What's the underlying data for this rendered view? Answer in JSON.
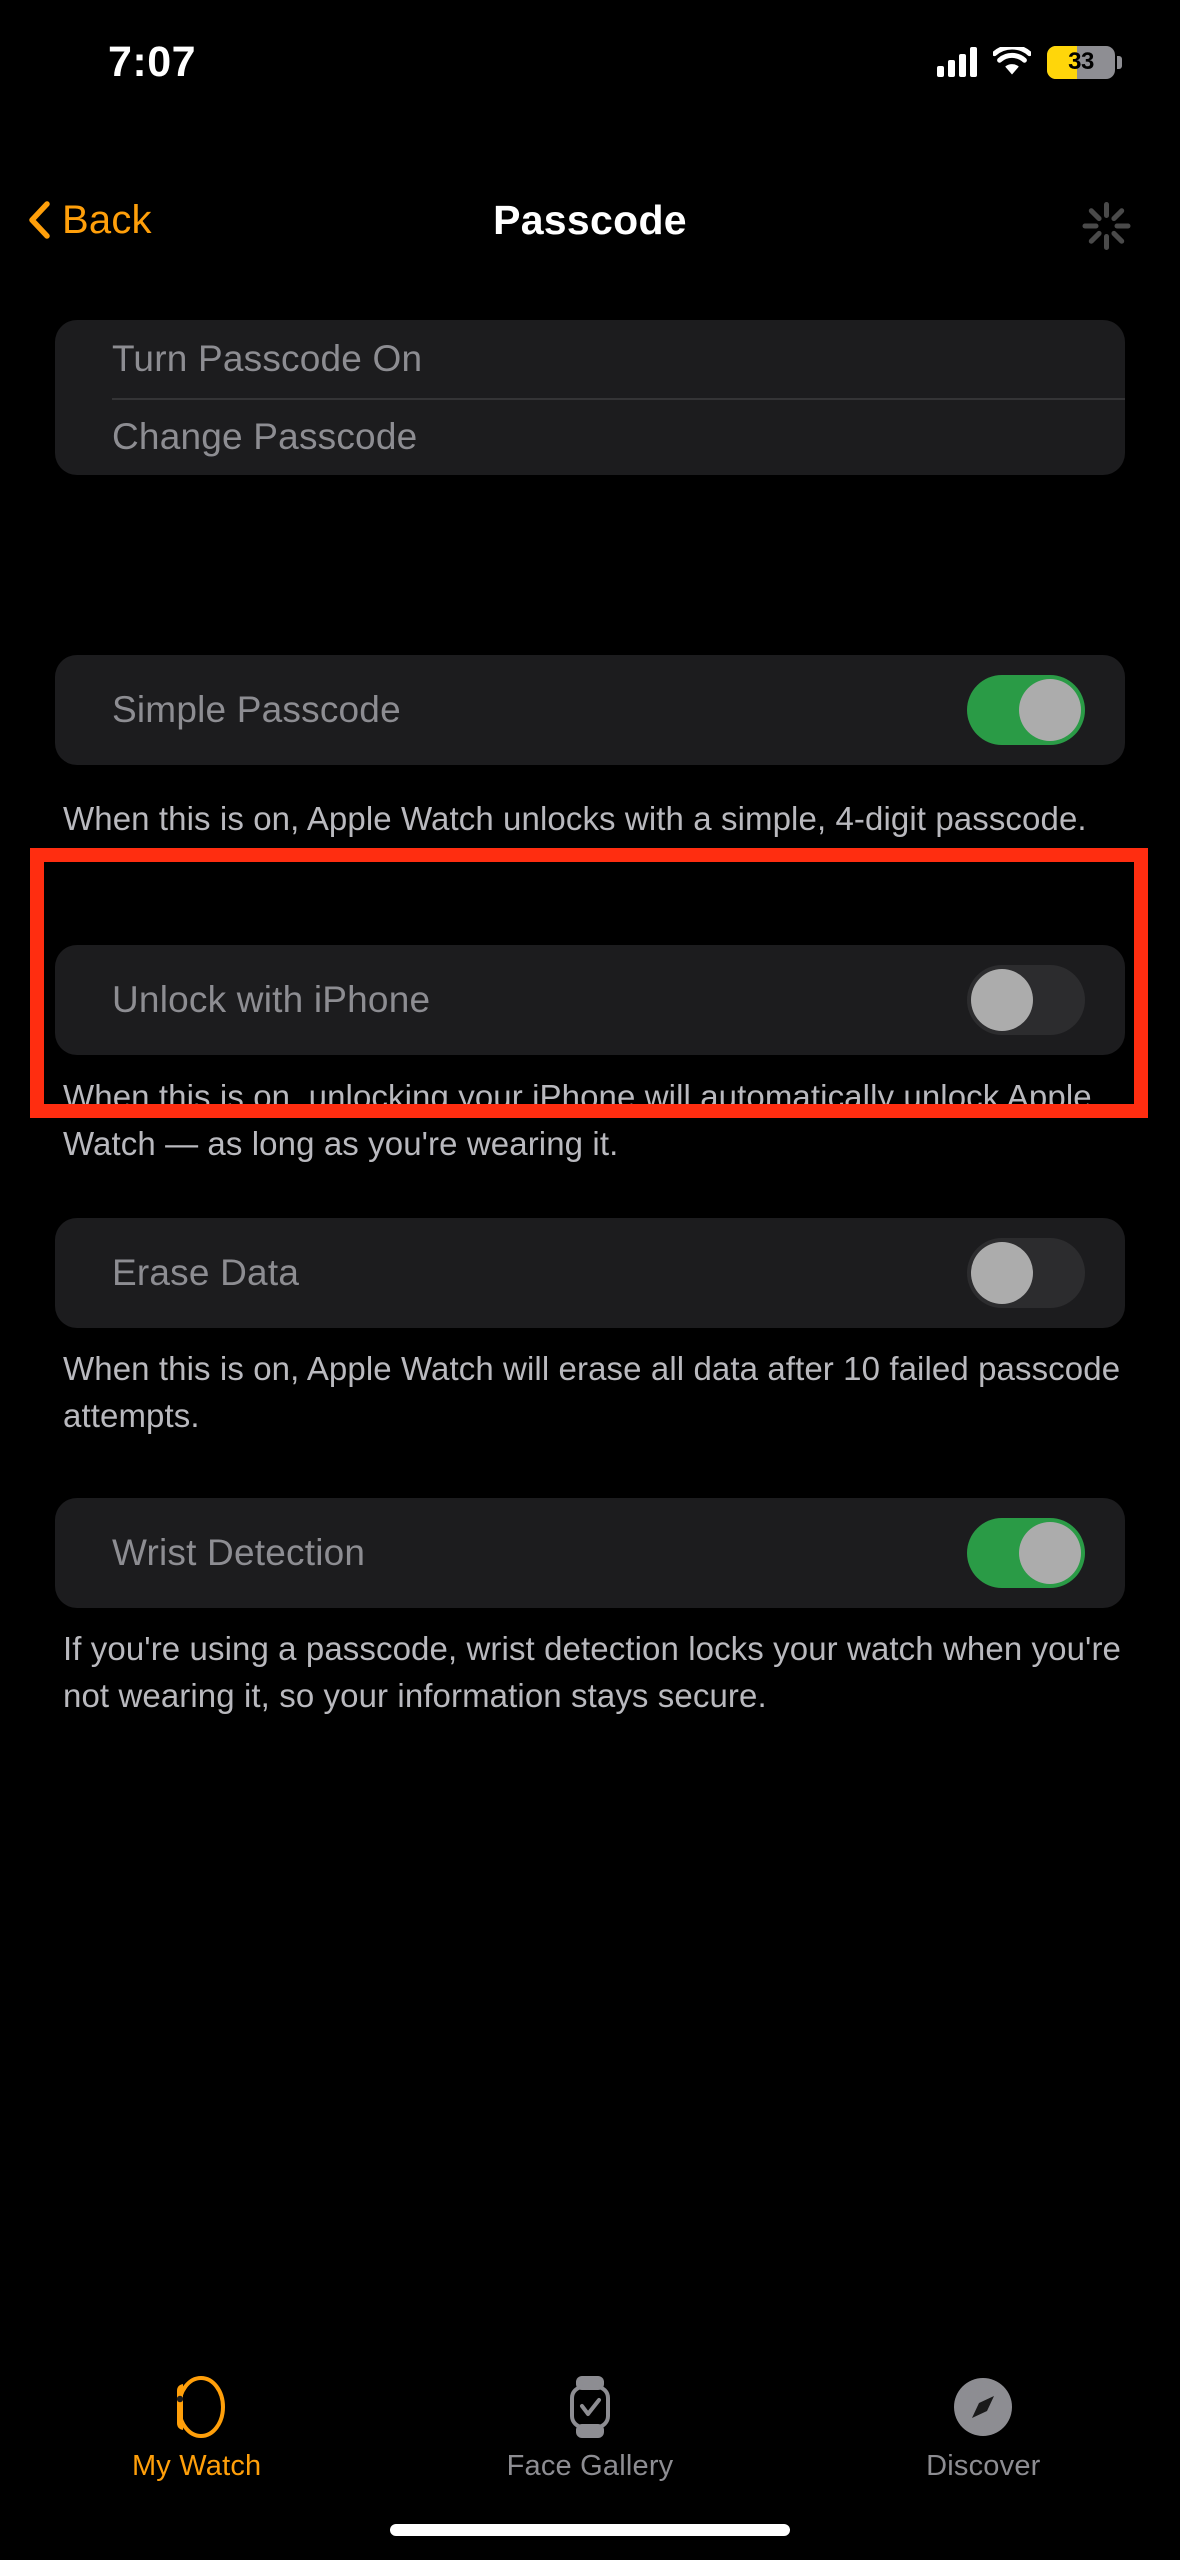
{
  "status_bar": {
    "time": "7:07",
    "signal_icon": "cellular-signal-icon",
    "wifi_icon": "wifi-icon",
    "battery_percent": "33",
    "battery_icon": "battery-low-power-icon"
  },
  "nav_bar": {
    "back_label": "Back",
    "back_icon": "chevron-left-icon",
    "title": "Passcode",
    "spinner_icon": "activity-spinner-icon"
  },
  "sections": [
    {
      "rows": [
        {
          "label": "Turn Passcode On",
          "type": "action",
          "disabled": true
        },
        {
          "label": "Change Passcode",
          "type": "action",
          "disabled": true
        }
      ],
      "footer": ""
    },
    {
      "rows": [
        {
          "label": "Simple Passcode",
          "type": "toggle",
          "value": "on",
          "disabled": true
        }
      ],
      "footer": "When this is on, Apple Watch unlocks with a simple, 4-digit passcode."
    },
    {
      "rows": [
        {
          "label": "Unlock with iPhone",
          "type": "toggle",
          "value": "off",
          "disabled": true
        }
      ],
      "footer": "When this is on, unlocking your iPhone will automatically unlock Apple Watch — as long as you're wearing it."
    },
    {
      "rows": [
        {
          "label": "Erase Data",
          "type": "toggle",
          "value": "off",
          "disabled": true
        }
      ],
      "footer": "When this is on, Apple Watch will erase all data after 10 failed passcode attempts."
    },
    {
      "rows": [
        {
          "label": "Wrist Detection",
          "type": "toggle",
          "value": "on",
          "disabled": true
        }
      ],
      "footer": "If you're using a passcode, wrist detection locks your watch when you're not wearing it, so your information stays secure."
    }
  ],
  "annotation": {
    "shape": "rectangle-highlight",
    "color": "#ff2d10",
    "targets": "Unlock with iPhone"
  },
  "tab_bar": {
    "tabs": [
      {
        "label": "My Watch",
        "icon": "watch-side-icon",
        "active": true
      },
      {
        "label": "Face Gallery",
        "icon": "watch-face-check-icon",
        "active": false
      },
      {
        "label": "Discover",
        "icon": "compass-icon",
        "active": false
      }
    ]
  },
  "colors": {
    "accent": "#ff9f0a",
    "toggle_on": "#2a9b46",
    "toggle_off": "#2c2c2e",
    "card": "#1c1c1e",
    "background": "#000000",
    "annotation": "#ff2d10",
    "battery": "#ffd60a"
  }
}
